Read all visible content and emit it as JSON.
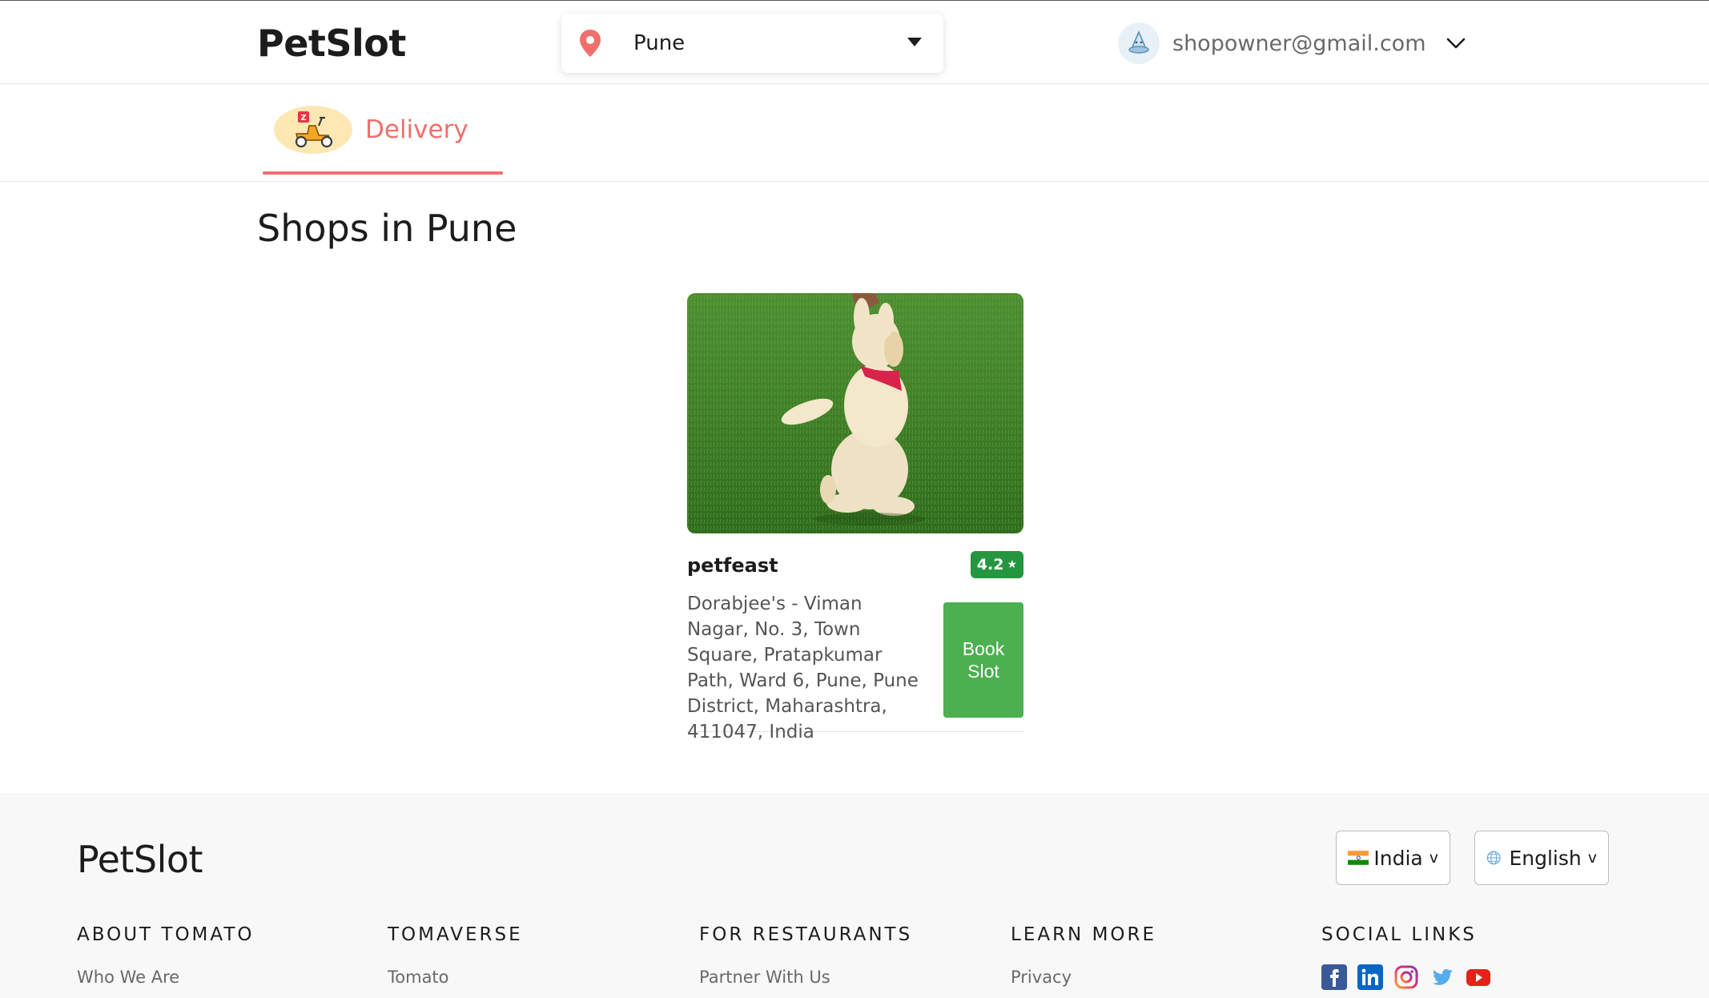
{
  "header": {
    "logo": "PetSlot",
    "location": {
      "value": "Pune",
      "placeholder": ""
    },
    "user_email": "shopowner@gmail.com"
  },
  "tabs": [
    {
      "label": "Delivery",
      "active": true,
      "icon": "scooter-icon"
    }
  ],
  "main": {
    "title": "Shops in Pune",
    "shops": [
      {
        "name": "petfeast",
        "rating": "4.2",
        "address": "Dorabjee's - Viman Nagar, No. 3, Town Square, Pratapkumar Path, Ward 6, Pune, Pune District, Maharashtra, 411047, India",
        "button_label_1": "Book",
        "button_label_2": "Slot",
        "image": "puppy-on-grass"
      }
    ]
  },
  "footer": {
    "logo": "PetSlot",
    "country": "India",
    "language": "English",
    "columns": [
      {
        "heading": "ABOUT TOMATO",
        "link": "Who We Are"
      },
      {
        "heading": "TOMAVERSE",
        "link": "Tomato"
      },
      {
        "heading": "FOR RESTAURANTS",
        "link": "Partner With Us"
      },
      {
        "heading": "LEARN MORE",
        "link": "Privacy"
      },
      {
        "heading": "SOCIAL LINKS",
        "icons": [
          "facebook-icon",
          "linkedin-icon",
          "instagram-icon",
          "twitter-icon",
          "youtube-icon"
        ]
      }
    ]
  },
  "colors": {
    "accent": "#ef6f6c",
    "rating_green": "#24963f",
    "button_green": "#4caf50"
  }
}
